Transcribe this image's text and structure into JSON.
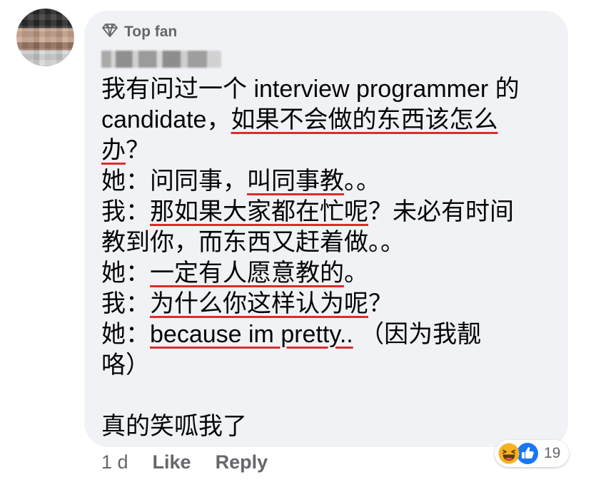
{
  "comment": {
    "badge_label": "Top fan",
    "badge_icon": "diamond-icon",
    "lines": [
      [
        {
          "t": "我有问过一个 interview programmer 的"
        }
      ],
      [
        {
          "t": "candidate，"
        },
        {
          "t": "如果不会做的东西该怎么",
          "u": true
        }
      ],
      [
        {
          "t": "办",
          "u": true
        },
        {
          "t": "？"
        }
      ],
      [
        {
          "t": "她："
        },
        {
          "t": "问同事，"
        },
        {
          "t": "叫同事教",
          "u": true
        },
        {
          "t": "。。"
        }
      ],
      [
        {
          "t": "我："
        },
        {
          "t": "那如果大家都在忙呢",
          "u": true
        },
        {
          "t": "？未必有时间"
        }
      ],
      [
        {
          "t": "教到你，而东西又赶着做。。"
        }
      ],
      [
        {
          "t": "她："
        },
        {
          "t": "一定有人愿意教的",
          "u": true
        },
        {
          "t": "。"
        }
      ],
      [
        {
          "t": "我："
        },
        {
          "t": "为什么你这样认为呢",
          "u": true
        },
        {
          "t": "？"
        }
      ],
      [
        {
          "t": "她："
        },
        {
          "t": "because im pretty..",
          "u": true
        },
        {
          "t": "  （因为我靓"
        }
      ],
      [
        {
          "t": "咯）"
        }
      ],
      [],
      [
        {
          "t": "真的笑呱我了"
        }
      ]
    ]
  },
  "footer": {
    "time": "1 d",
    "like_label": "Like",
    "reply_label": "Reply"
  },
  "reactions": {
    "count": "19",
    "icons": [
      "laugh-icon",
      "like-icon"
    ],
    "colors": {
      "laugh": "#f7b125",
      "like": "#1877f2",
      "underline": "#e02a2a"
    }
  }
}
